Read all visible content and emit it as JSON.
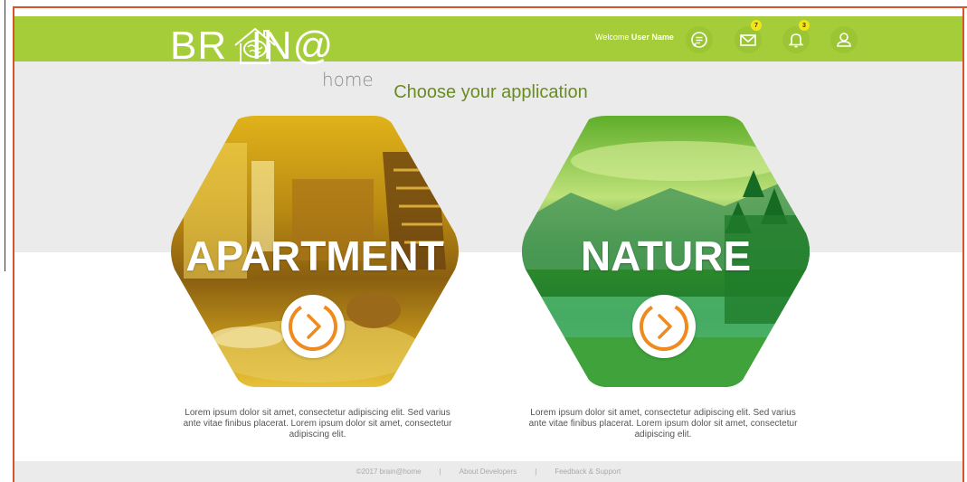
{
  "header": {
    "logo_main": "BR  IN@",
    "logo_sub": "home",
    "welcome_prefix": "Welcome",
    "welcome_user": "User Name",
    "mail_badge": "7",
    "notif_badge": "3",
    "colors": {
      "bar": "#a5cd39",
      "badge": "#f4e41c"
    }
  },
  "main": {
    "title": "Choose your application",
    "cards": [
      {
        "label": "APARTMENT",
        "description": "Lorem ipsum dolor sit amet, consectetur adipiscing elit. Sed varius ante vitae finibus placerat. Lorem ipsum dolor sit amet, consectetur adipiscing elit."
      },
      {
        "label": "NATURE",
        "description": "Lorem ipsum dolor sit amet, consectetur adipiscing elit. Sed varius ante vitae finibus placerat. Lorem ipsum dolor sit amet, consectetur adipiscing elit."
      }
    ],
    "accent": "#ef8a1f"
  },
  "footer": {
    "copyright": "©2017 brain@home",
    "sep1": "|",
    "developers": "About Developers",
    "sep2": "|",
    "support": "Feedback & Support"
  }
}
